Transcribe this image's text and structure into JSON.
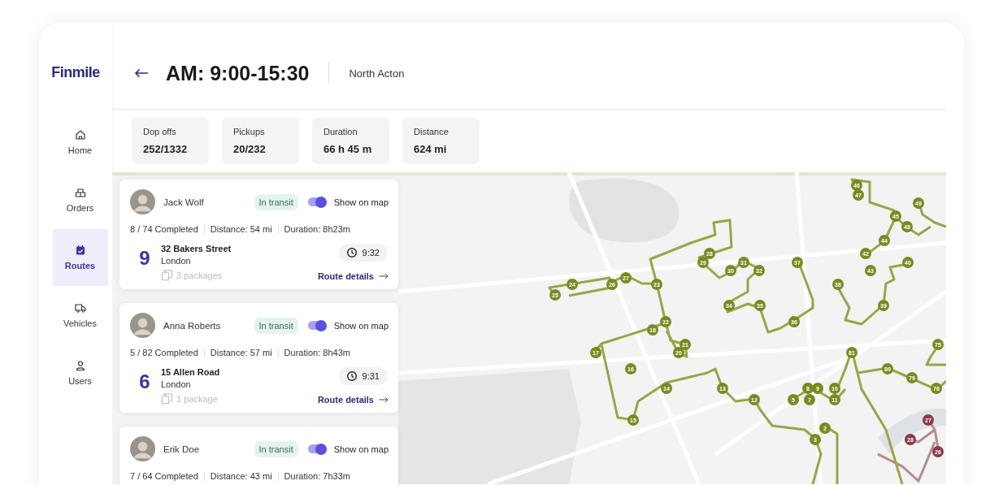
{
  "brand": {
    "logo": "Finmile"
  },
  "sidebar": {
    "items": [
      {
        "label": "Home",
        "selected": false
      },
      {
        "label": "Orders",
        "selected": false
      },
      {
        "label": "Routes",
        "selected": true
      },
      {
        "label": "Vehicles",
        "selected": false
      },
      {
        "label": "Users",
        "selected": false
      }
    ]
  },
  "header": {
    "title": "AM: 9:00-15:30",
    "location": "North Acton"
  },
  "stats": [
    {
      "label": "Dop offs",
      "value": "252/1332"
    },
    {
      "label": "Pickups",
      "value": "20/232"
    },
    {
      "label": "Duration",
      "value": "66 h 45 m"
    },
    {
      "label": "Distance",
      "value": "624 mi"
    }
  ],
  "routes": [
    {
      "driver": "Jack Wolf",
      "status": "In transit",
      "show_on_map": true,
      "toggle_label": "Show on map",
      "completed": "8 / 74 Completed",
      "distance": "Distance: 54 mi",
      "duration": "Duration: 8h23m",
      "next_stop": {
        "number": "9",
        "street": "32 Bakers Street",
        "city": "London",
        "packages": "3 packages",
        "eta": "9:32"
      },
      "link": "Route details"
    },
    {
      "driver": "Anna Roberts",
      "status": "In transit",
      "show_on_map": true,
      "toggle_label": "Show on map",
      "completed": "5 / 82 Completed",
      "distance": "Distance: 57 mi",
      "duration": "Duration: 8h43m",
      "next_stop": {
        "number": "6",
        "street": "15 Allen Road",
        "city": "London",
        "packages": "1 package",
        "eta": "9:31"
      },
      "link": "Route details"
    },
    {
      "driver": "Erik Doe",
      "status": "In transit",
      "show_on_map": true,
      "toggle_label": "Show on map",
      "completed": "7 / 64 Completed",
      "distance": "Distance: 43 mi",
      "duration": "Duration: 7h33m"
    }
  ],
  "map": {
    "stops": [
      {
        "label": "46",
        "color": "#7b8a20"
      },
      {
        "label": "47",
        "color": "#7b8a20"
      },
      {
        "label": "49",
        "color": "#7b8a20"
      },
      {
        "label": "45",
        "color": "#7b8a20"
      },
      {
        "label": "48",
        "color": "#7b8a20"
      },
      {
        "label": "44",
        "color": "#7b8a20"
      },
      {
        "label": "28",
        "color": "#7b8a20"
      },
      {
        "label": "42",
        "color": "#7b8a20"
      },
      {
        "label": "29",
        "color": "#7b8a20"
      },
      {
        "label": "31",
        "color": "#7b8a20"
      },
      {
        "label": "37",
        "color": "#7b8a20"
      },
      {
        "label": "40",
        "color": "#7b8a20"
      },
      {
        "label": "30",
        "color": "#7b8a20"
      },
      {
        "label": "32",
        "color": "#7b8a20"
      },
      {
        "label": "43",
        "color": "#7b8a20"
      },
      {
        "label": "27",
        "color": "#7b8a20"
      },
      {
        "label": "24",
        "color": "#7b8a20"
      },
      {
        "label": "26",
        "color": "#7b8a20"
      },
      {
        "label": "23",
        "color": "#7b8a20"
      },
      {
        "label": "38",
        "color": "#7b8a20"
      },
      {
        "label": "25",
        "color": "#7b8a20"
      },
      {
        "label": "34",
        "color": "#7b8a20"
      },
      {
        "label": "35",
        "color": "#7b8a20"
      },
      {
        "label": "39",
        "color": "#7b8a20"
      },
      {
        "label": "22",
        "color": "#7b8a20"
      },
      {
        "label": "36",
        "color": "#7b8a20"
      },
      {
        "label": "18",
        "color": "#7b8a20"
      },
      {
        "label": "21",
        "color": "#7b8a20"
      },
      {
        "label": "75",
        "color": "#7b8a20"
      },
      {
        "label": "17",
        "color": "#7b8a20"
      },
      {
        "label": "20",
        "color": "#7b8a20"
      },
      {
        "label": "81",
        "color": "#7b8a20"
      },
      {
        "label": "16",
        "color": "#7b8a20"
      },
      {
        "label": "80",
        "color": "#7b8a20"
      },
      {
        "label": "79",
        "color": "#7b8a20"
      },
      {
        "label": "14",
        "color": "#7b8a20"
      },
      {
        "label": "13",
        "color": "#7b8a20"
      },
      {
        "label": "8",
        "color": "#7b8a20"
      },
      {
        "label": "9",
        "color": "#7b8a20"
      },
      {
        "label": "10",
        "color": "#7b8a20"
      },
      {
        "label": "76",
        "color": "#7b8a20"
      },
      {
        "label": "12",
        "color": "#7b8a20"
      },
      {
        "label": "5",
        "color": "#7b8a20"
      },
      {
        "label": "7",
        "color": "#7b8a20"
      },
      {
        "label": "11",
        "color": "#7b8a20"
      },
      {
        "label": "15",
        "color": "#7b8a20"
      },
      {
        "label": "27",
        "color": "#8a3a4a"
      },
      {
        "label": "2",
        "color": "#7b8a20"
      },
      {
        "label": "3",
        "color": "#7b8a20"
      },
      {
        "label": "28",
        "color": "#8a3a4a"
      },
      {
        "label": "26",
        "color": "#8a3a4a"
      }
    ]
  }
}
